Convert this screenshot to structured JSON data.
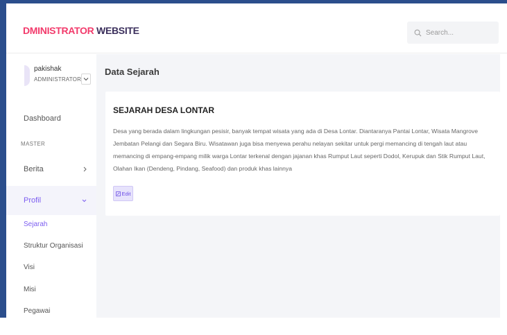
{
  "header": {
    "brand_accent": "DMINISTRATOR",
    "brand_rest": "WEBSITE",
    "search_placeholder": "Search...",
    "search_icon": "search-icon"
  },
  "user": {
    "name": "pakishak",
    "role": "ADMINISTRATOR",
    "toggle_icon": "chevron-down-icon"
  },
  "sidebar": {
    "dashboard_label": "Dashboard",
    "section_label": "MASTER",
    "berita_label": "Berita",
    "profil_label": "Profil",
    "sub_items": [
      "Sejarah",
      "Struktur Organisasi",
      "Visi",
      "Misi",
      "Pegawai"
    ],
    "active_sub_item": "Sejarah"
  },
  "content": {
    "page_title": "Data Sejarah",
    "card_title": "SEJARAH DESA LONTAR",
    "card_text": "Desa yang berada dalam lingkungan pesisir, banyak tempat wisata yang ada di Desa Lontar. Diantaranya Pantai Lontar, Wisata Mangrove Jembatan Pelangi dan Segara Biru. Wisatawan juga bisa menyewa perahu nelayan sekitar untuk pergi memancing di tengah laut atau memancing di empang-empang milik warga Lontar terkenal dengan jajanan khas Rumput Laut seperti Dodol, Kerupuk dan Stik Rumput Laut, Olahan Ikan (Dendeng, Pindang, Seafood) dan produk khas lainnya",
    "edit_label": "Edit"
  },
  "colors": {
    "brand_accent": "#f23a6b",
    "brand_dark": "#3b2f5c",
    "primary": "#7b5cf0",
    "frame": "#2b4e8c"
  }
}
